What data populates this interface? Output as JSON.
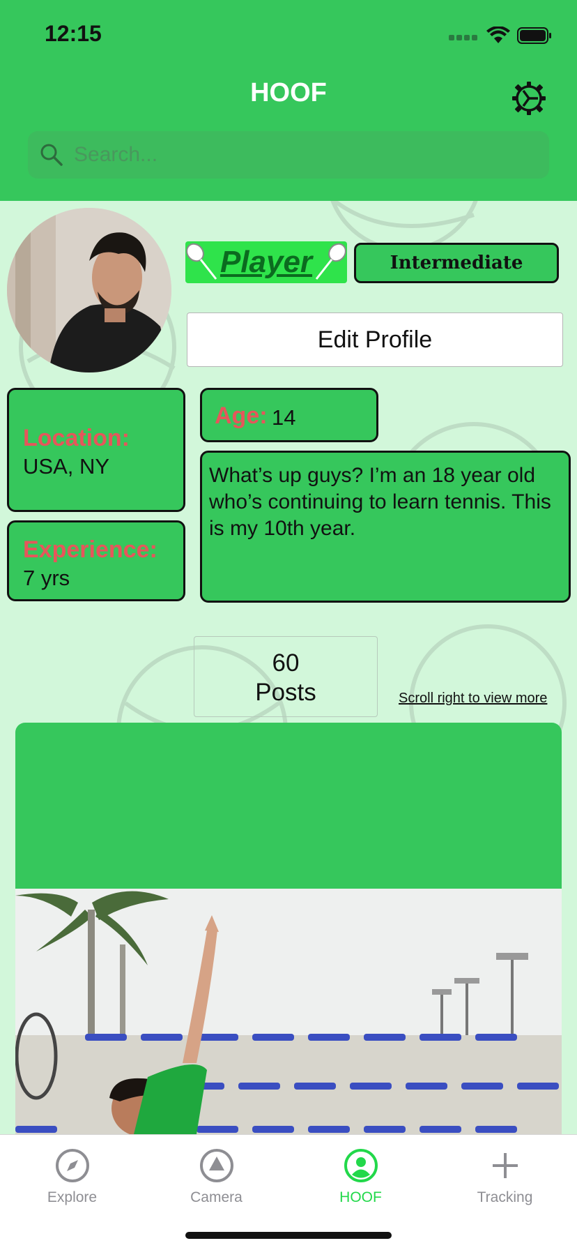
{
  "status_bar": {
    "time": "12:15"
  },
  "header": {
    "title": "HOOF",
    "settings_icon": "gear-icon"
  },
  "search": {
    "placeholder": "Search..."
  },
  "profile": {
    "role": "Player",
    "level": "Intermediate",
    "edit_button": "Edit Profile",
    "location_label": "Location:",
    "location_value": "USA, NY",
    "experience_label": "Experience:",
    "experience_value": "7 yrs",
    "age_label": "Age:",
    "age_value": "14",
    "bio": "What’s up guys? I’m an 18 year old who’s continuing to learn tennis. This is my 10th year."
  },
  "posts": {
    "count": "60",
    "label": "Posts",
    "scroll_hint": "Scroll right to view more"
  },
  "tab_bar": {
    "tabs": [
      {
        "label": "Explore",
        "icon": "compass-icon",
        "active": false
      },
      {
        "label": "Camera",
        "icon": "camera-triangle-icon",
        "active": false
      },
      {
        "label": "HOOF",
        "icon": "profile-icon",
        "active": true
      },
      {
        "label": "Tracking",
        "icon": "plus-icon",
        "active": false
      }
    ]
  },
  "colors": {
    "brand_green": "#36c75c",
    "background_mint": "#d2f7da",
    "label_red": "#e6565b",
    "active_tab": "#22d84a"
  }
}
